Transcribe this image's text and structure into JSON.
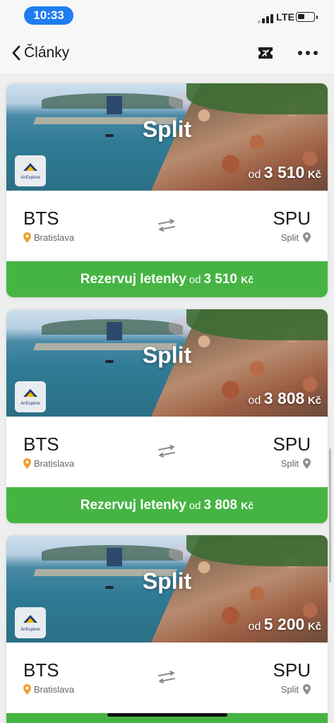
{
  "status_bar": {
    "time": "10:33",
    "network": "LTE"
  },
  "nav": {
    "back_label": "Články"
  },
  "cards": [
    {
      "city": "Split",
      "brand": "AirExplore",
      "price_prefix": "od",
      "price": "3 510",
      "currency": "Kč",
      "from_code": "BTS",
      "from_city": "Bratislava",
      "to_code": "SPU",
      "to_city": "Split",
      "book_label": "Rezervuj letenky",
      "book_prefix": "od",
      "book_price": "3 510",
      "book_currency": "Kč"
    },
    {
      "city": "Split",
      "brand": "AirExplore",
      "price_prefix": "od",
      "price": "3 808",
      "currency": "Kč",
      "from_code": "BTS",
      "from_city": "Bratislava",
      "to_code": "SPU",
      "to_city": "Split",
      "book_label": "Rezervuj letenky",
      "book_prefix": "od",
      "book_price": "3 808",
      "book_currency": "Kč"
    },
    {
      "city": "Split",
      "brand": "AirExplore",
      "price_prefix": "od",
      "price": "5 200",
      "currency": "Kč",
      "from_code": "BTS",
      "from_city": "Bratislava",
      "to_code": "SPU",
      "to_city": "Split"
    }
  ],
  "colors": {
    "accent_green": "#46b443",
    "time_pill_blue": "#1e7df0",
    "pin_orange": "#f0a030"
  }
}
